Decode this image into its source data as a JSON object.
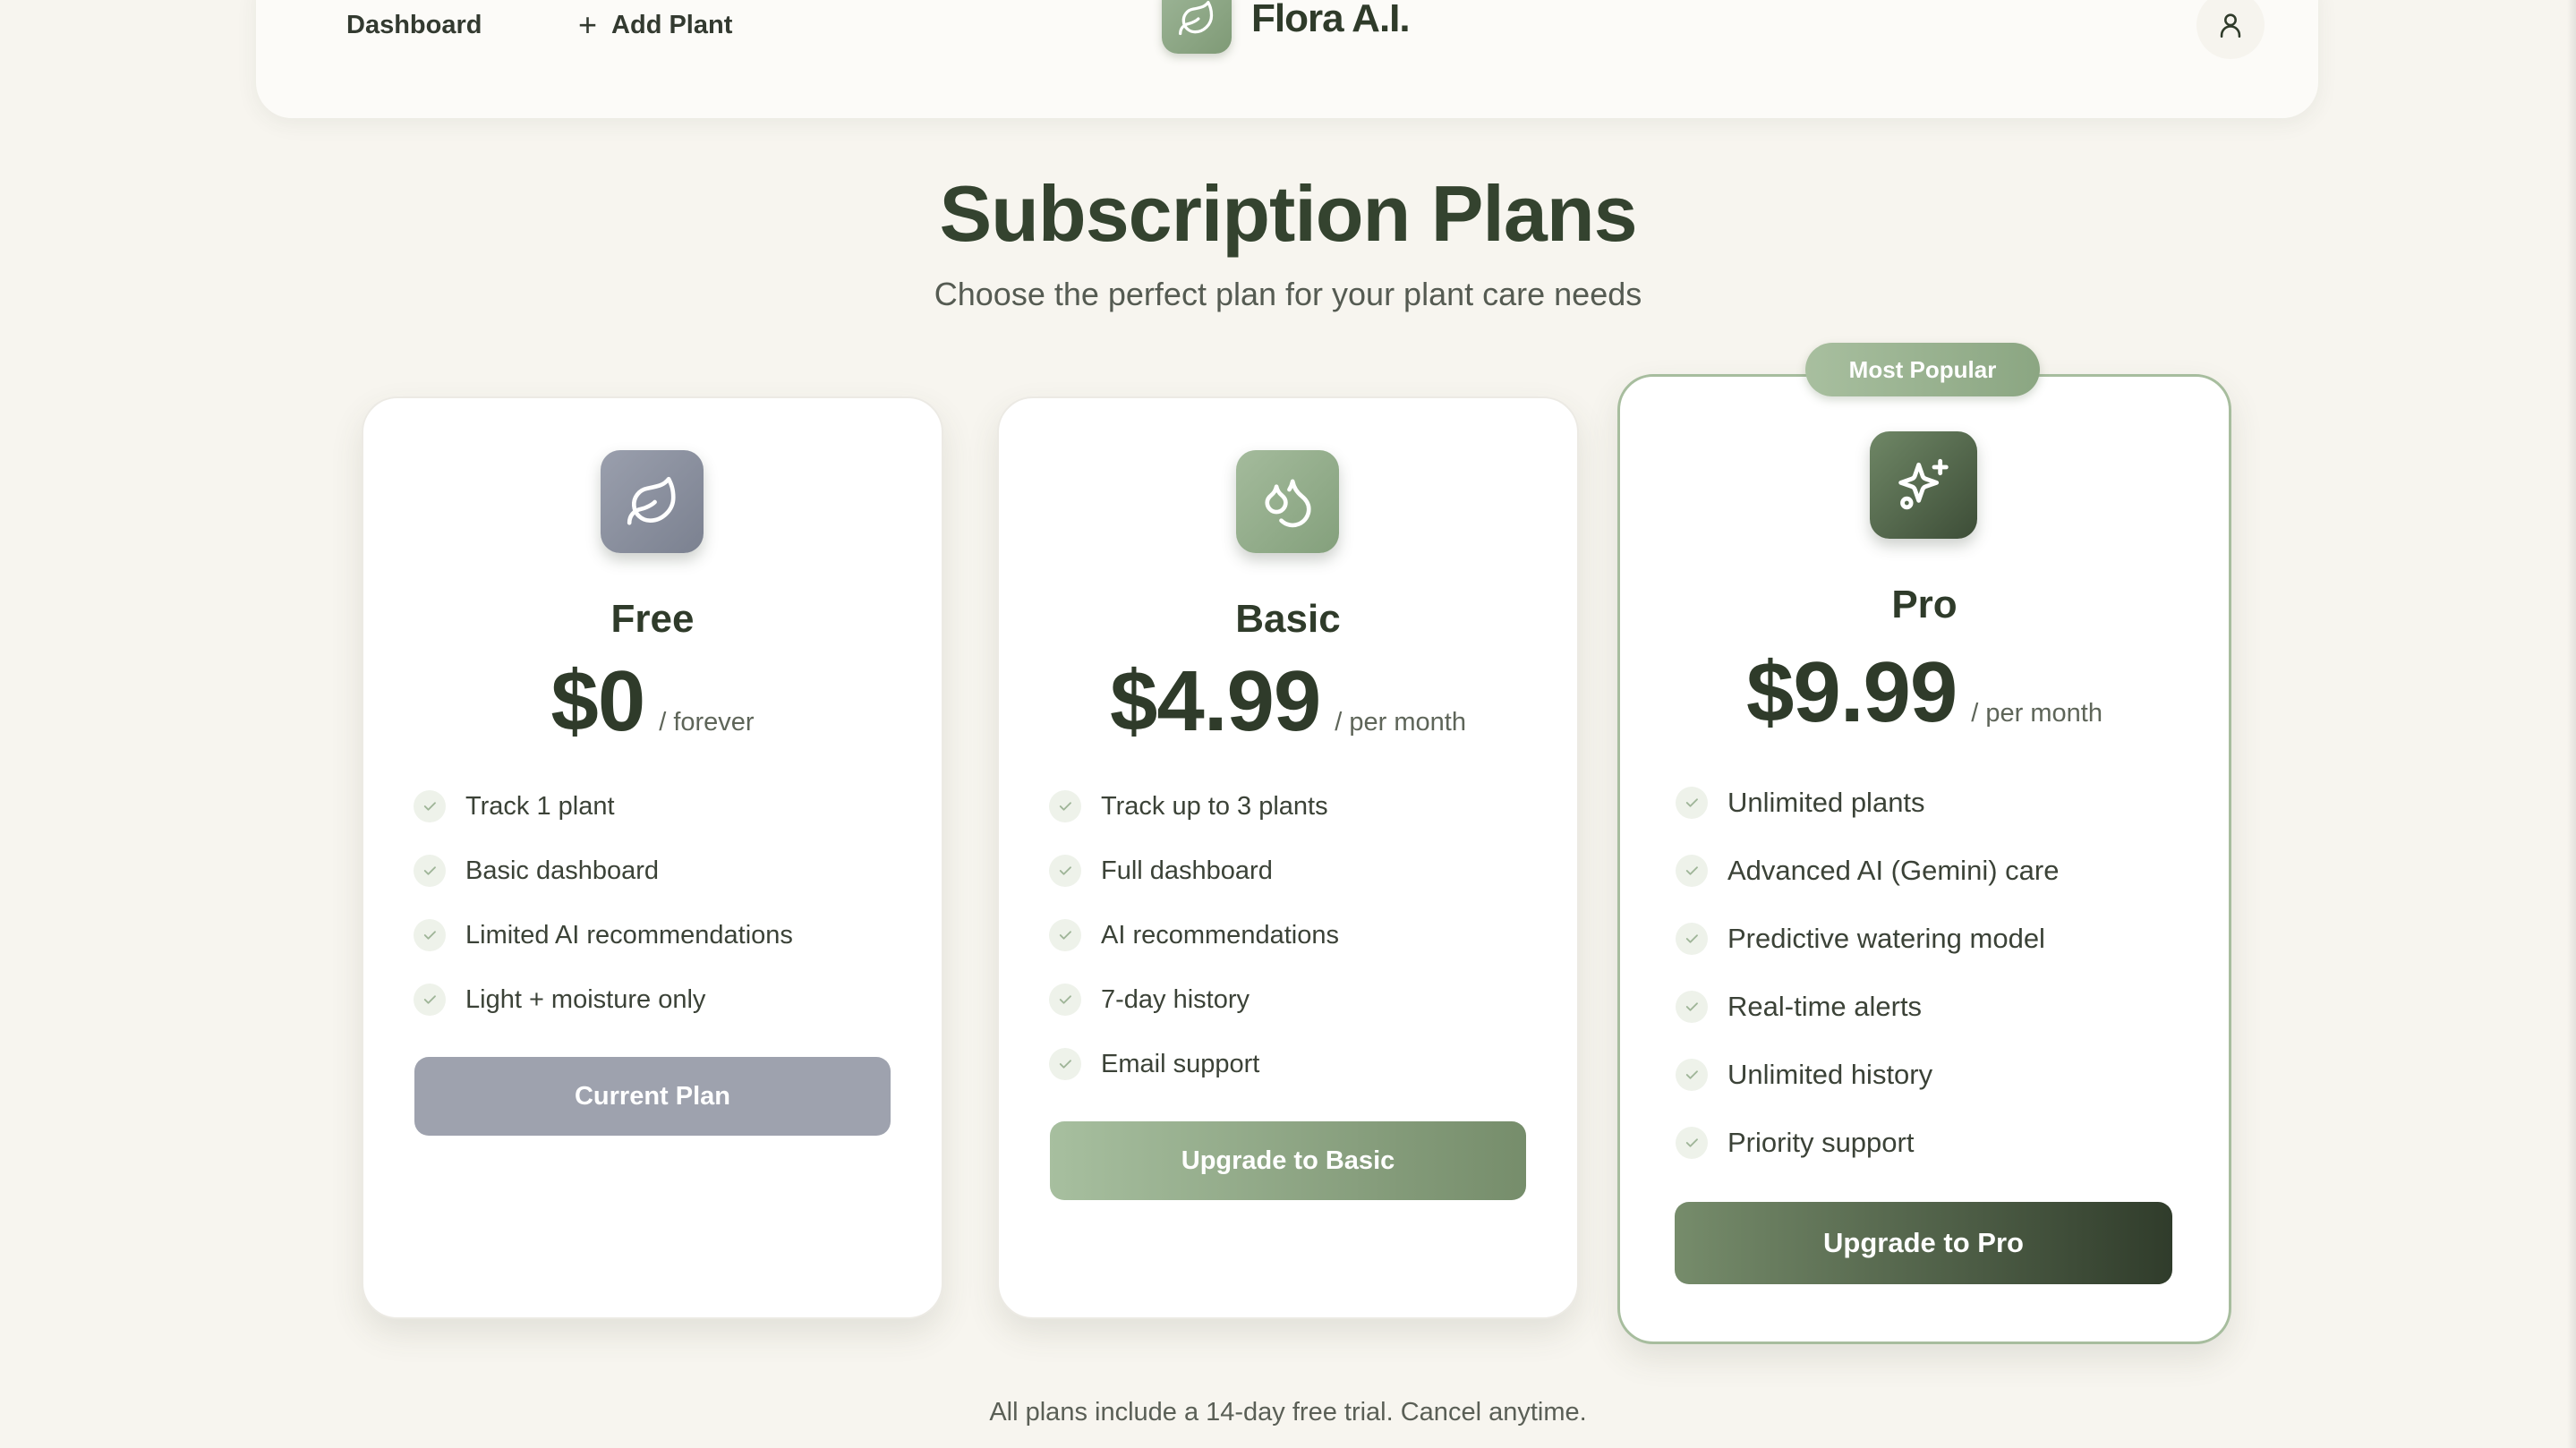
{
  "nav": {
    "dashboard_label": "Dashboard",
    "add_plant_label": "Add Plant",
    "brand_name": "Flora A.I.",
    "logo_icon": "leaf-icon",
    "user_icon": "user-icon"
  },
  "header": {
    "title": "Subscription Plans",
    "subtitle": "Choose the perfect plan for your plant care needs"
  },
  "plans": [
    {
      "name": "Free",
      "icon": "leaf-icon",
      "price": "$0",
      "period": "/ forever",
      "features": [
        "Track 1 plant",
        "Basic dashboard",
        "Limited AI recommendations",
        "Light + moisture only"
      ],
      "button_label": "Current Plan"
    },
    {
      "name": "Basic",
      "icon": "droplets-icon",
      "price": "$4.99",
      "period": "/ per month",
      "features": [
        "Track up to 3 plants",
        "Full dashboard",
        "AI recommendations",
        "7-day history",
        "Email support"
      ],
      "button_label": "Upgrade to Basic"
    },
    {
      "name": "Pro",
      "icon": "sparkles-icon",
      "badge": "Most Popular",
      "price": "$9.99",
      "period": "/ per month",
      "features": [
        "Unlimited plants",
        "Advanced AI (Gemini) care",
        "Predictive watering model",
        "Real-time alerts",
        "Unlimited history",
        "Priority support"
      ],
      "button_label": "Upgrade to Pro"
    }
  ],
  "footer": {
    "note": "All plans include a 14-day free trial. Cancel anytime."
  },
  "colors": {
    "background": "#f7f5ef",
    "text_dark": "#2f3b2a",
    "sage": "#8ba682",
    "forest": "#3d4d37",
    "gray_button": "#9ea2ae"
  }
}
